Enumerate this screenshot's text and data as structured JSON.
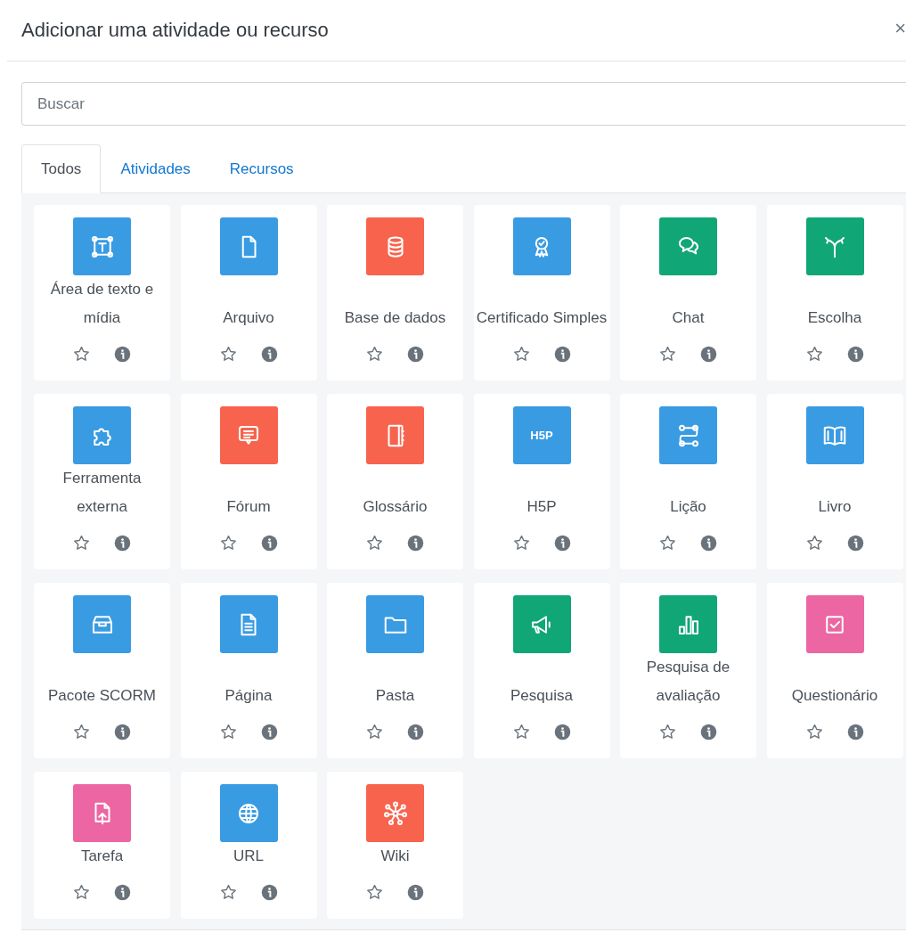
{
  "modal": {
    "title": "Adicionar uma atividade ou recurso",
    "close": "×"
  },
  "search": {
    "placeholder": "Buscar"
  },
  "tabs": [
    {
      "label": "Todos",
      "selected": true
    },
    {
      "label": "Atividades",
      "selected": false
    },
    {
      "label": "Recursos",
      "selected": false
    }
  ],
  "items": [
    {
      "name": "Área de texto e mídia",
      "color": "#399be2",
      "starred": false
    },
    {
      "name": "Arquivo",
      "color": "#399be2",
      "starred": false
    },
    {
      "name": "Base de dados",
      "color": "#f7634d",
      "starred": false
    },
    {
      "name": "Certificado Simples",
      "color": "#399be2",
      "starred": false
    },
    {
      "name": "Chat",
      "color": "#11a676",
      "starred": false
    },
    {
      "name": "Escolha",
      "color": "#11a676",
      "starred": false
    },
    {
      "name": "Ferramenta externa",
      "color": "#399be2",
      "starred": false
    },
    {
      "name": "Fórum",
      "color": "#f7634d",
      "starred": false
    },
    {
      "name": "Glossário",
      "color": "#f7634d",
      "starred": false
    },
    {
      "name": "H5P",
      "color": "#399be2",
      "starred": false,
      "icon_text": "H5P"
    },
    {
      "name": "Lição",
      "color": "#399be2",
      "starred": false
    },
    {
      "name": "Livro",
      "color": "#399be2",
      "starred": false
    },
    {
      "name": "Pacote SCORM",
      "color": "#399be2",
      "starred": false
    },
    {
      "name": "Página",
      "color": "#399be2",
      "starred": false
    },
    {
      "name": "Pasta",
      "color": "#399be2",
      "starred": false
    },
    {
      "name": "Pesquisa",
      "color": "#11a676",
      "starred": false
    },
    {
      "name": "Pesquisa de avaliação",
      "color": "#11a676",
      "starred": false
    },
    {
      "name": "Questionário",
      "color": "#eb66a2",
      "starred": false
    },
    {
      "name": "Tarefa",
      "color": "#eb66a2",
      "starred": false
    },
    {
      "name": "URL",
      "color": "#399be2",
      "starred": false
    },
    {
      "name": "Wiki",
      "color": "#f7634d",
      "starred": false
    }
  ]
}
